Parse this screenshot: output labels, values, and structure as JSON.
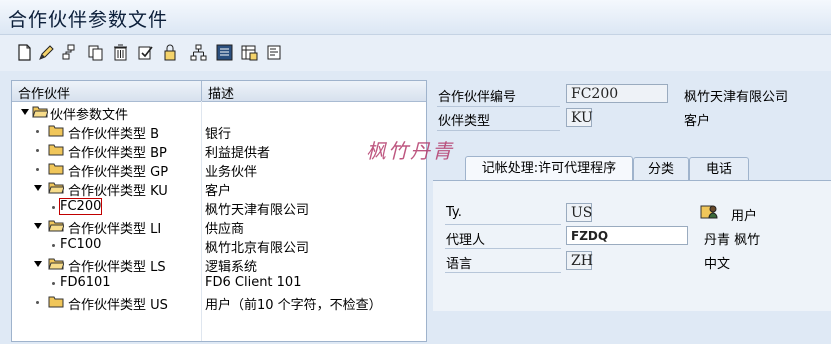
{
  "window": {
    "title": "合作伙伴参数文件"
  },
  "toolbar": {
    "buttons": [
      "new-icon",
      "edit-icon",
      "hierarchy-icon",
      "copy-icon",
      "delete-icon",
      "check-icon",
      "lock-icon",
      "org-icon",
      "detail-icon",
      "config-icon",
      "print-icon"
    ]
  },
  "tree": {
    "col_partner": "合作伙伴",
    "col_desc": "描述",
    "root": "伙伴参数文件",
    "rows": [
      {
        "label": "合作伙伴类型 B",
        "desc": "银行"
      },
      {
        "label": "合作伙伴类型 BP",
        "desc": "利益提供者"
      },
      {
        "label": "合作伙伴类型 GP",
        "desc": "业务伙伴"
      },
      {
        "label": "合作伙伴类型 KU",
        "desc": "客户"
      },
      {
        "label": "FC200",
        "desc": "枫竹天津有限公司"
      },
      {
        "label": "合作伙伴类型 LI",
        "desc": "供应商"
      },
      {
        "label": "FC100",
        "desc": "枫竹北京有限公司"
      },
      {
        "label": "合作伙伴类型 LS",
        "desc": "逻辑系统"
      },
      {
        "label": "FD6101",
        "desc": "FD6 Client 101"
      },
      {
        "label": "合作伙伴类型 US",
        "desc": "用户（前10 个字符，不检查）"
      }
    ]
  },
  "detail": {
    "partner_no_label": "合作伙伴编号",
    "partner_no": "FC200",
    "partner_name": "枫竹天津有限公司",
    "partner_type_label": "伙伴类型",
    "partner_type": "KU",
    "partner_type_text": "客户"
  },
  "tabs": [
    "记帐处理:许可代理程序",
    "分类",
    "电话"
  ],
  "posting": {
    "ty_label": "Ty.",
    "ty_value": "US",
    "ty_text": "用户",
    "agent_label": "代理人",
    "agent_value": "FZDQ",
    "agent_text": "丹青 枫竹",
    "lang_label": "语言",
    "lang_value": "ZH",
    "lang_text": "中文"
  },
  "watermark": "枫竹丹青",
  "colors": {
    "background": "#dfe9f5",
    "selection_outline": "#c00000",
    "folder": "#e8b84a"
  }
}
